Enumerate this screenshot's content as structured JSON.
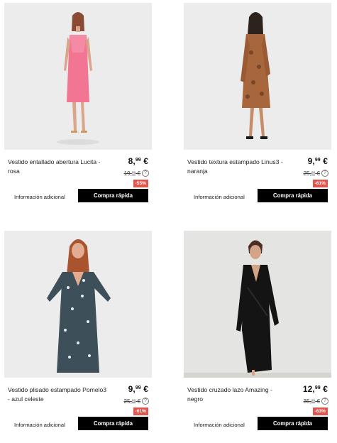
{
  "products": [
    {
      "name": "Vestido entallado abertura Lucita - rosa",
      "price_int": "8,",
      "price_dec": "99",
      "currency": "€",
      "old_int": "19,",
      "old_dec": "99",
      "discount": "-55%",
      "more_label": "Información adicional",
      "buy_label": "Compra rápida",
      "dress_color": "#f27593",
      "info_icon": "?"
    },
    {
      "name": "Vestido textura estampado Linus3 - naranja",
      "price_int": "9,",
      "price_dec": "99",
      "currency": "€",
      "old_int": "25,",
      "old_dec": "99",
      "discount": "-61%",
      "more_label": "Información adicional",
      "buy_label": "Compra rápida",
      "dress_color": "#a8663c",
      "info_icon": "?"
    },
    {
      "name": "Vestido plisado estampado Pomelo3 - azul celeste",
      "price_int": "9,",
      "price_dec": "99",
      "currency": "€",
      "old_int": "25,",
      "old_dec": "99",
      "discount": "-61%",
      "more_label": "Información adicional",
      "buy_label": "Compra rápida",
      "dress_color": "#3d4f58",
      "info_icon": "?"
    },
    {
      "name": "Vestido cruzado lazo Amazing - negro",
      "price_int": "12,",
      "price_dec": "99",
      "currency": "€",
      "old_int": "35,",
      "old_dec": "99",
      "discount": "-63%",
      "more_label": "Información adicional",
      "buy_label": "Compra rápida",
      "dress_color": "#141414",
      "info_icon": "?"
    }
  ]
}
